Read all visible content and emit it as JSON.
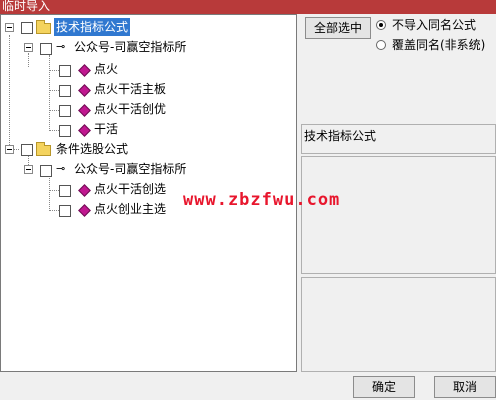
{
  "window": {
    "title": "临时导入"
  },
  "tree": {
    "groups": [
      {
        "label": "技术指标公式",
        "selected": true,
        "subgroup": "公众号-司赢空指标所",
        "items": [
          "点火",
          "点火干活主板",
          "点火干活创优",
          "干活"
        ]
      },
      {
        "label": "条件选股公式",
        "selected": false,
        "subgroup": "公众号-司赢空指标所",
        "items": [
          "点火干活创选",
          "点火创业主选"
        ]
      }
    ]
  },
  "right_panel": {
    "select_all_label": "全部选中",
    "options": [
      {
        "label": "不导入同名公式",
        "checked": true
      },
      {
        "label": "覆盖同名(非系统)",
        "checked": false
      }
    ],
    "preview_title": "技术指标公式"
  },
  "watermark": "www.zbzfwu.com",
  "footer": {
    "ok_label": "确定",
    "cancel_label": "取消"
  },
  "colors": {
    "titlebar": "#b83a3a",
    "selection": "#3078d0",
    "formula_icon": "#c0178f",
    "watermark": "#e8162d"
  }
}
